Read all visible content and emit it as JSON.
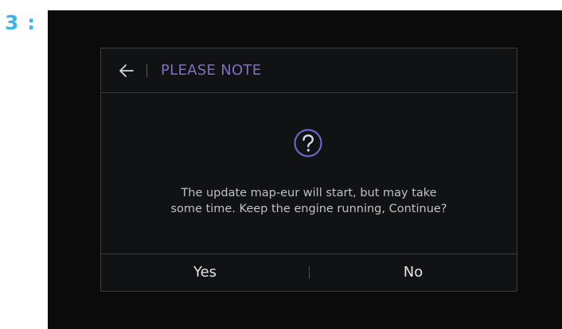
{
  "step": {
    "label": "3 :"
  },
  "dialog": {
    "back_icon": "arrow-left-icon",
    "title": "PLEASE NOTE",
    "status_icon": "question-circle-icon",
    "message_lines": [
      "The update map-eur will start, but may take",
      "some time. Keep the engine running, Continue?"
    ],
    "buttons": {
      "yes": "Yes",
      "no": "No"
    }
  },
  "colors": {
    "step_label": "#3fb2e6",
    "screen_background": "#0b0b0c",
    "title_accent": "#7d6fc2",
    "text": "#bfc0c4"
  }
}
